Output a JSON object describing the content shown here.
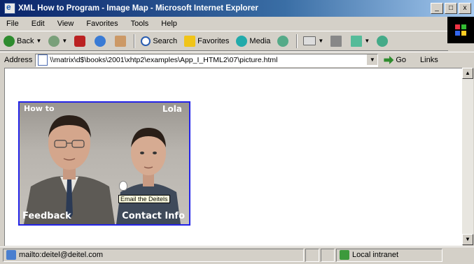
{
  "window": {
    "title": "XML How to Program - Image Map - Microsoft Internet Explorer",
    "controls": [
      "_",
      "□",
      "x"
    ]
  },
  "menu": [
    "File",
    "Edit",
    "View",
    "Favorites",
    "Tools",
    "Help"
  ],
  "toolbar": {
    "back": "Back",
    "search": "Search",
    "favorites": "Favorites",
    "media": "Media"
  },
  "address": {
    "label": "Address",
    "value": "\\\\matrix\\d$\\books\\2001\\xhtp2\\examples\\App_I_HTML2\\07\\picture.html",
    "go": "Go",
    "links": "Links"
  },
  "imagemap": {
    "hotspots": {
      "howto": "How to",
      "lola": "Lola",
      "feedback": "Feedback",
      "contact": "Contact Info"
    },
    "tooltip": "Email the Deitels"
  },
  "status": {
    "text": "mailto:deitel@deitel.com",
    "zone": "Local intranet"
  },
  "colors": {
    "titlebar_start": "#0a246a",
    "titlebar_end": "#a6caf0",
    "chrome": "#d4d0c8",
    "imagemap_border": "#2323e8"
  },
  "icons": {
    "back": "back-arrow-icon",
    "forward": "forward-arrow-icon",
    "stop": "stop-icon",
    "refresh": "refresh-icon",
    "home": "home-icon",
    "search": "search-icon",
    "favorites": "favorites-icon",
    "media": "media-icon",
    "history": "history-icon",
    "mail": "mail-icon",
    "print": "print-icon",
    "edit": "edit-icon",
    "messenger": "messenger-icon"
  }
}
